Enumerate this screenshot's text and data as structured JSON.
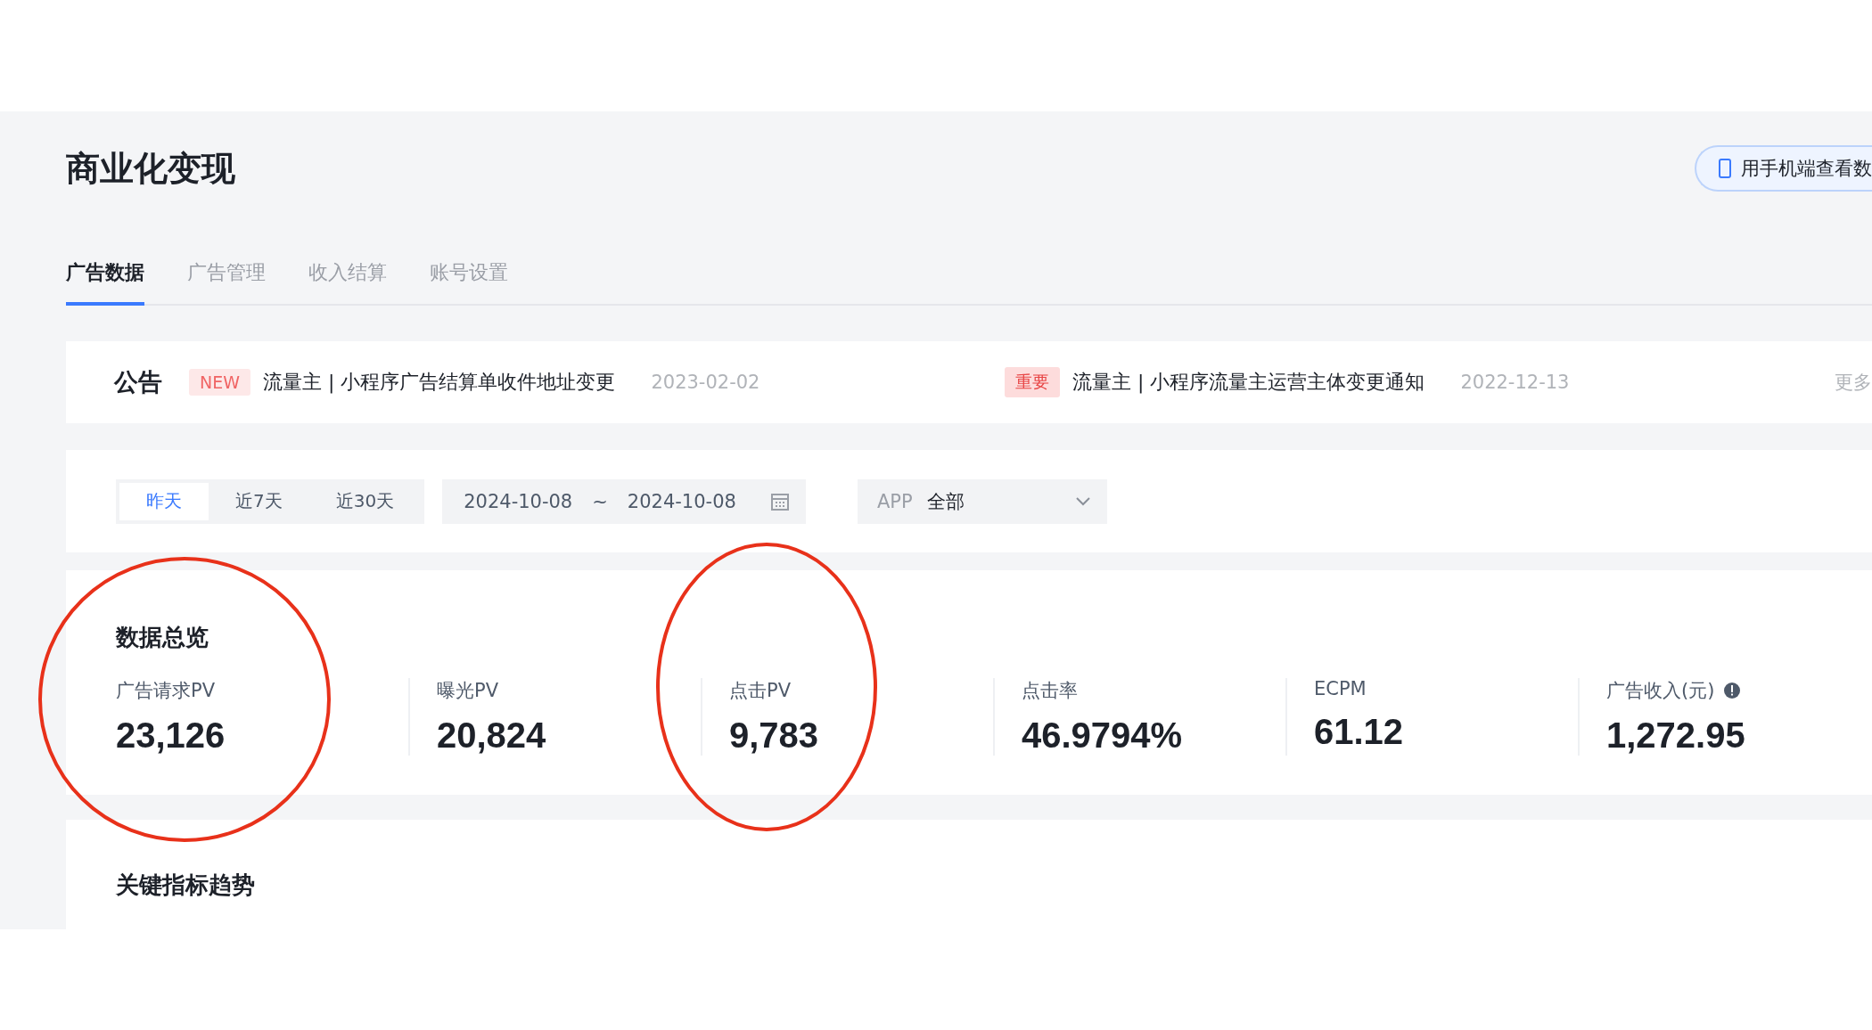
{
  "header": {
    "title": "商业化变现",
    "mobile_button": "用手机端查看数"
  },
  "tabs": [
    {
      "label": "广告数据",
      "selected": true
    },
    {
      "label": "广告管理",
      "selected": false
    },
    {
      "label": "收入结算",
      "selected": false
    },
    {
      "label": "账号设置",
      "selected": false
    }
  ],
  "notice": {
    "label": "公告",
    "more": "更多",
    "items": [
      {
        "tag": "NEW",
        "kind": "new",
        "text": "流量主 | 小程序广告结算单收件地址变更",
        "date": "2023-02-02"
      },
      {
        "tag": "重要",
        "kind": "important",
        "text": "流量主 | 小程序流量主运营主体变更通知",
        "date": "2022-12-13"
      }
    ]
  },
  "filters": {
    "ranges": [
      {
        "label": "昨天",
        "selected": true
      },
      {
        "label": "近7天",
        "selected": false
      },
      {
        "label": "近30天",
        "selected": false
      }
    ],
    "date_start": "2024-10-08",
    "separator": "~",
    "date_end": "2024-10-08",
    "app_label": "APP",
    "app_value": "全部"
  },
  "overview": {
    "title": "数据总览",
    "metrics": [
      {
        "label": "广告请求PV",
        "value": "23,126",
        "info": false
      },
      {
        "label": "曝光PV",
        "value": "20,824",
        "info": false
      },
      {
        "label": "点击PV",
        "value": "9,783",
        "info": false
      },
      {
        "label": "点击率",
        "value": "46.9794%",
        "info": false
      },
      {
        "label": "ECPM",
        "value": "61.12",
        "info": false
      },
      {
        "label": "广告收入(元)",
        "value": "1,272.95",
        "info": true
      }
    ]
  },
  "trend": {
    "title": "关键指标趋势"
  }
}
